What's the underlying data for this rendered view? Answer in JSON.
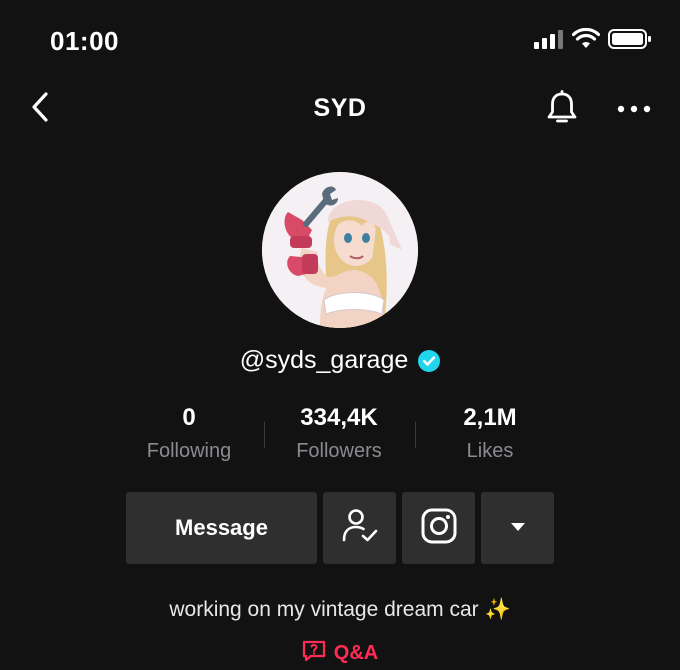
{
  "status_bar": {
    "time": "01:00",
    "icons": [
      "cellular-signal-icon",
      "wifi-icon",
      "battery-icon"
    ]
  },
  "nav": {
    "title": "SYD",
    "back_icon": "chevron-left-icon",
    "bell_icon": "bell-icon",
    "more_icon": "more-dots-icon"
  },
  "profile": {
    "username": "@syds_garage",
    "verified": true,
    "avatar_description_icon": "avatar-illustration"
  },
  "stats": [
    {
      "value": "0",
      "label": "Following"
    },
    {
      "value": "334,4K",
      "label": "Followers"
    },
    {
      "value": "2,1M",
      "label": "Likes"
    }
  ],
  "actions": {
    "message_label": "Message",
    "friends_icon": "person-check-icon",
    "instagram_icon": "instagram-icon",
    "dropdown_icon": "caret-down-icon"
  },
  "bio": {
    "text": "working on my vintage dream car ✨"
  },
  "qa": {
    "label": "Q&A",
    "icon": "question-bubble-icon"
  },
  "colors": {
    "background": "#121212",
    "button": "#2f2f2f",
    "muted_text": "#8a8b91",
    "accent": "#fe2c55",
    "verified": "#20d5ec"
  }
}
